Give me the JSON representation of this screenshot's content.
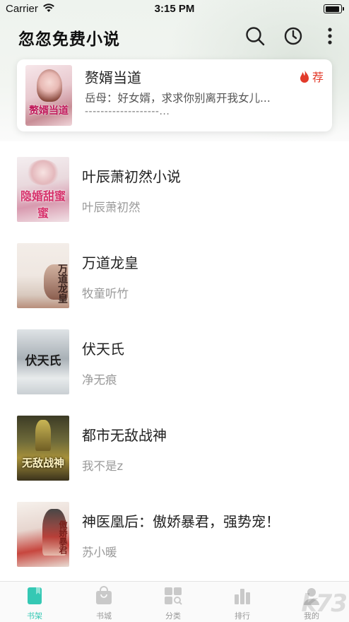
{
  "status_bar": {
    "carrier": "Carrier",
    "time": "3:15 PM"
  },
  "app": {
    "title": "忽忽免费小说"
  },
  "icons": {
    "search": "search-icon",
    "history": "history-icon",
    "more": "more-vertical-icon",
    "hot": "fire-icon"
  },
  "recommend": {
    "title": "赘婿当道",
    "badge": "荐",
    "description": "岳母：好女婿，求求你别离开我女儿...",
    "description2": "-------------------...",
    "cover_text": "赘婿当道"
  },
  "books": [
    {
      "title": "叶辰萧初然小说",
      "author": "叶辰萧初然",
      "cover_text": "隐婚甜蜜蜜"
    },
    {
      "title": "万道龙皇",
      "author": "牧童听竹",
      "cover_text": "万道龙皇"
    },
    {
      "title": "伏天氏",
      "author": "净无痕",
      "cover_text": "伏天氏"
    },
    {
      "title": "都市无敌战神",
      "author": "我不是z",
      "cover_text": "无敌战神"
    },
    {
      "title": "神医凰后：傲娇暴君，强势宠！",
      "author": "苏小暖",
      "cover_text": "傲娇暴君"
    }
  ],
  "tabs": [
    {
      "label": "书架",
      "icon": "bookshelf-icon",
      "active": true
    },
    {
      "label": "书城",
      "icon": "store-bag-icon",
      "active": false
    },
    {
      "label": "分类",
      "icon": "category-grid-icon",
      "active": false
    },
    {
      "label": "排行",
      "icon": "ranking-icon",
      "active": false
    },
    {
      "label": "我的",
      "icon": "profile-icon",
      "active": false
    }
  ],
  "colors": {
    "accent": "#35c8b4",
    "hot": "#e23a2a",
    "title": "#222222",
    "author": "#9a9a9a"
  },
  "watermark": "k73"
}
